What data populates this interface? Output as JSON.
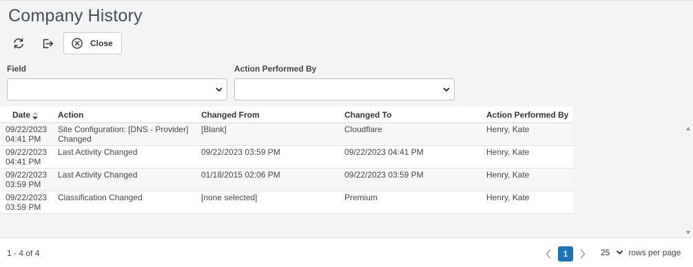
{
  "page": {
    "title": "Company History"
  },
  "toolbar": {
    "refresh_icon": "refresh-icon",
    "export_icon": "export-icon",
    "close_label": "Close"
  },
  "filters": {
    "field_label": "Field",
    "field_value": "",
    "performed_by_label": "Action Performed By",
    "performed_by_value": ""
  },
  "grid": {
    "columns": [
      "Date",
      "Action",
      "Changed From",
      "Changed To",
      "Action Performed By"
    ],
    "sort": {
      "column": "Date",
      "direction": "descending"
    },
    "rows": [
      {
        "date": "09/22/2023",
        "time": "04:41 PM",
        "action": "Site Configuration: [DNS - Provider] Changed",
        "from": "[Blank]",
        "to": "Cloudflare",
        "by": "Henry, Kate"
      },
      {
        "date": "09/22/2023",
        "time": "04:41 PM",
        "action": "Last Activity Changed",
        "from": "09/22/2023 03:59 PM",
        "to": "09/22/2023 04:41 PM",
        "by": "Henry, Kate"
      },
      {
        "date": "09/22/2023",
        "time": "03:59 PM",
        "action": "Last Activity Changed",
        "from": "01/18/2015 02:06 PM",
        "to": "09/22/2023 03:59 PM",
        "by": "Henry, Kate"
      },
      {
        "date": "09/22/2023",
        "time": "03:59 PM",
        "action": "Classification Changed",
        "from": "[none selected]",
        "to": "Premium",
        "by": "Henry, Kate"
      }
    ]
  },
  "footer": {
    "record_count": "1 - 4 of 4",
    "current_page": "1",
    "rows_per_page": "25",
    "rows_per_page_label": "rows per page"
  },
  "colors": {
    "accent": "#1a73b8",
    "title": "#3d4f5c"
  }
}
